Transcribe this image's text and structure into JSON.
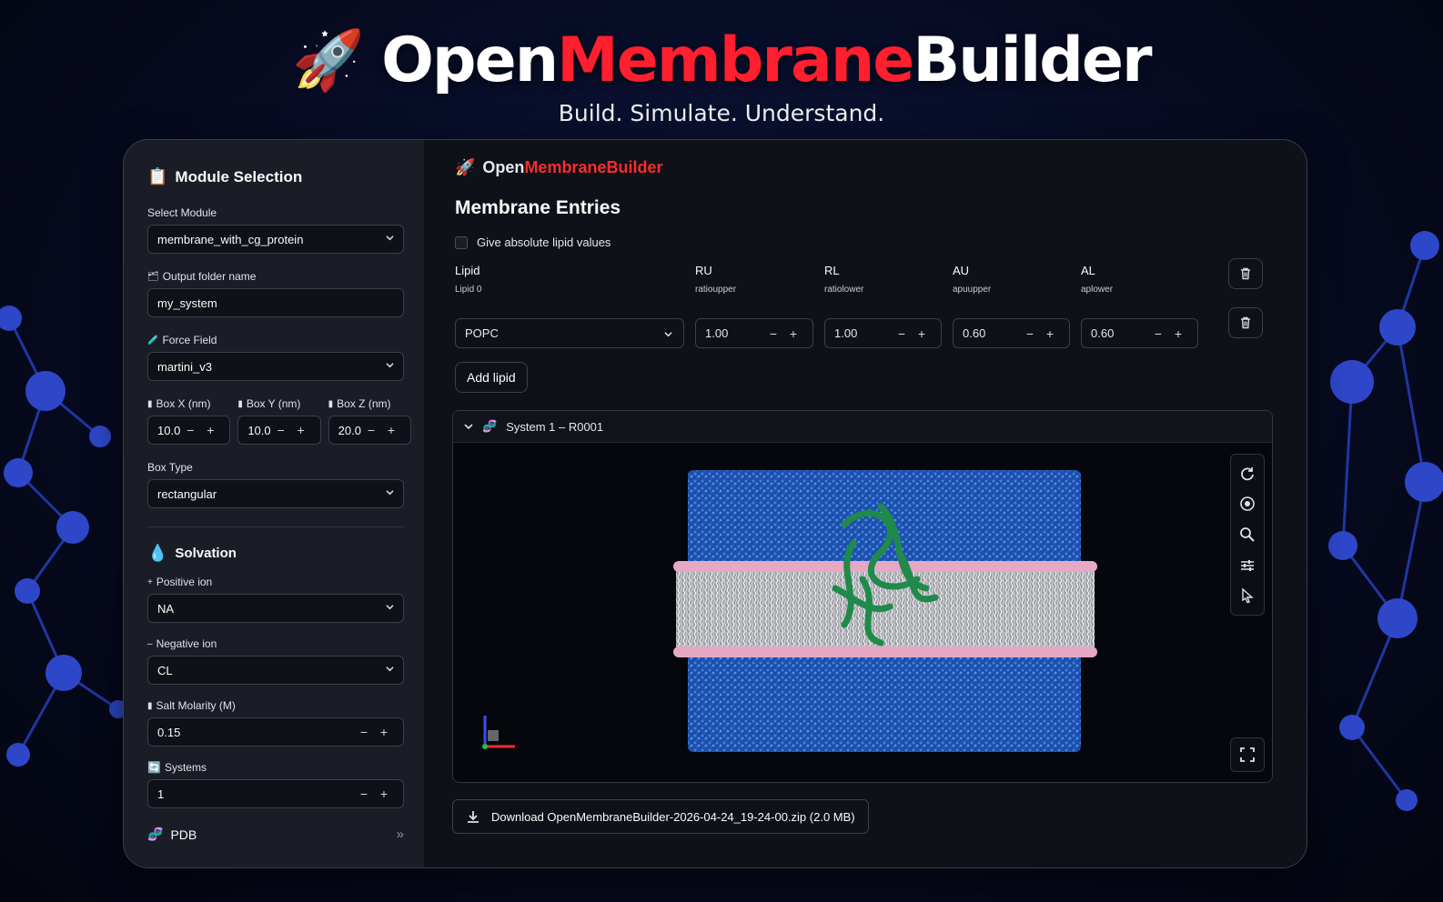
{
  "hero": {
    "title_part1": "Open",
    "title_part2": "Membrane",
    "title_part3": "Builder",
    "subtitle": "Build. Simulate. Understand.",
    "accent_color": "#ff1f2e",
    "rocket_icon": "rocket-icon"
  },
  "sidebar": {
    "module_title": "Module Selection",
    "select_module_label": "Select Module",
    "select_module_value": "membrane_with_cg_protein",
    "output_folder_label": "Output folder name",
    "output_folder_value": "my_system",
    "force_field_label": "Force Field",
    "force_field_value": "martini_v3",
    "box_x_label": "Box X (nm)",
    "box_x_value": "10.0",
    "box_y_label": "Box Y (nm)",
    "box_y_value": "10.0",
    "box_z_label": "Box Z (nm)",
    "box_z_value": "20.0",
    "box_type_label": "Box Type",
    "box_type_value": "rectangular",
    "solvation_title": "Solvation",
    "positive_ion_label": "Positive ion",
    "positive_ion_value": "NA",
    "negative_ion_label": "Negative ion",
    "negative_ion_value": "CL",
    "salt_label": "Salt Molarity (M)",
    "salt_value": "0.15",
    "systems_label": "Systems",
    "systems_value": "1",
    "pdb_label": "PDB",
    "minus": "−",
    "plus": "+"
  },
  "main": {
    "brand_part1": "Open",
    "brand_part2": "MembraneBuilder",
    "heading": "Membrane Entries",
    "checkbox_label": "Give absolute lipid values",
    "columns": [
      {
        "header": "Lipid",
        "sub": "Lipid 0",
        "value": "POPC"
      },
      {
        "header": "RU",
        "sub": "ratioupper",
        "value": "1.00"
      },
      {
        "header": "RL",
        "sub": "ratiolower",
        "value": "1.00"
      },
      {
        "header": "AU",
        "sub": "apuupper",
        "value": "0.60"
      },
      {
        "header": "AL",
        "sub": "aplower",
        "value": "0.60"
      }
    ],
    "add_lipid_label": "Add lipid",
    "system_label": "System 1 – R0001",
    "download_label": "Download OpenMembraneBuilder-2026-04-24_19-24-00.zip (2.0 MB)"
  }
}
